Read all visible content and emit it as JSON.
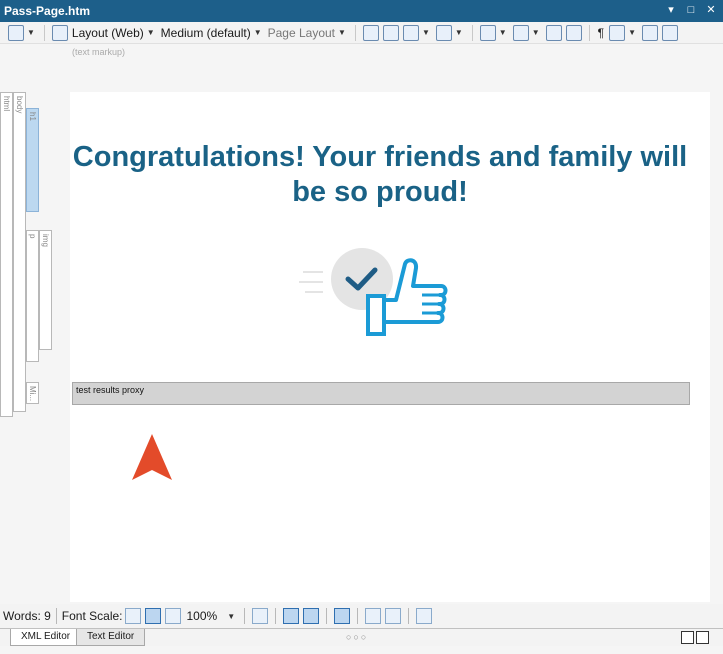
{
  "window": {
    "title": "Pass-Page.htm"
  },
  "toolbar": {
    "layout_label": "Layout (Web)",
    "size_label": "Medium (default)",
    "page_layout_label": "Page Layout"
  },
  "hint": {
    "text": "(text markup)"
  },
  "tags": {
    "html": "html",
    "body": "body",
    "h1": "h1",
    "p": "p",
    "img": "img",
    "mi": "Mi..."
  },
  "page": {
    "heading": "Congratulations! Your friends and family will be so proud!",
    "proxy_text": "test results proxy",
    "colors": {
      "heading": "#1a6286",
      "icon_blue": "#1b9bd6",
      "check_dark": "#1f5c85",
      "circle": "#e4e4e4",
      "cursor": "#e34b2a"
    }
  },
  "statusbar": {
    "words": "Words: 9",
    "font_scale_label": "Font Scale:",
    "zoom": "100%"
  },
  "tabs": {
    "xml": "XML Editor",
    "text": "Text Editor",
    "dots": "○○○"
  }
}
